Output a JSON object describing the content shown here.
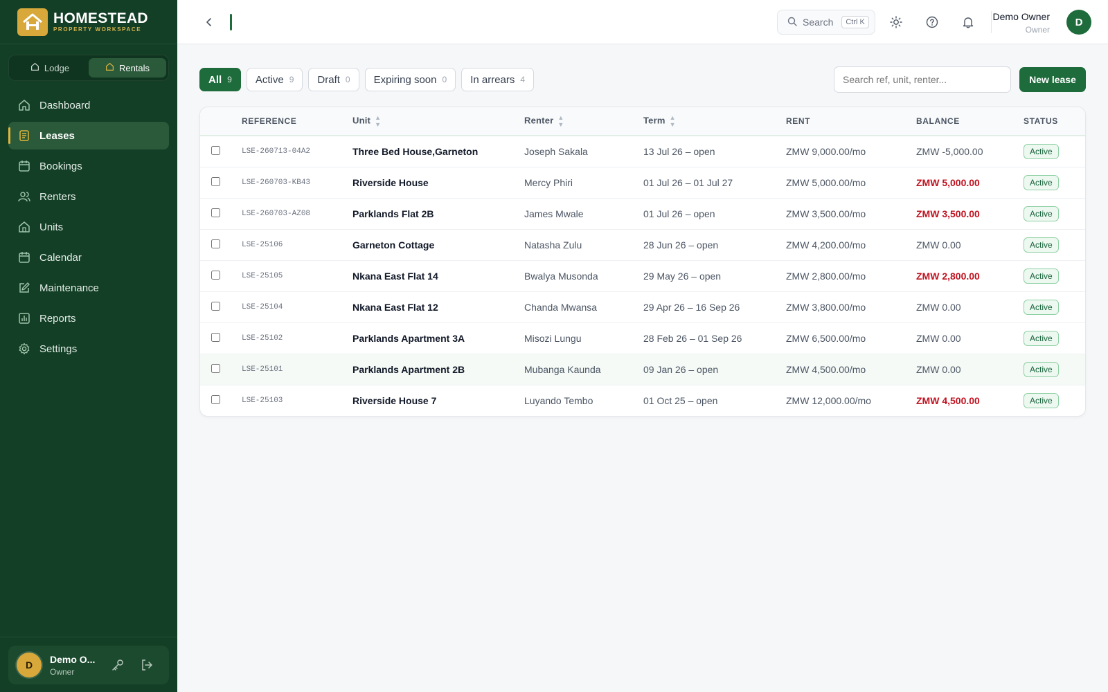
{
  "brand": {
    "name": "HOMESTEAD",
    "tagline": "PROPERTY WORKSPACE"
  },
  "mode_switch": [
    {
      "label": "Lodge",
      "active": false
    },
    {
      "label": "Rentals",
      "active": true
    }
  ],
  "sidebar": {
    "items": [
      {
        "label": "Dashboard",
        "icon": "home-icon",
        "active": false
      },
      {
        "label": "Leases",
        "icon": "document-icon",
        "active": true
      },
      {
        "label": "Bookings",
        "icon": "calendar-icon",
        "active": false
      },
      {
        "label": "Renters",
        "icon": "users-icon",
        "active": false
      },
      {
        "label": "Units",
        "icon": "building-icon",
        "active": false
      },
      {
        "label": "Calendar",
        "icon": "calendar-icon",
        "active": false
      },
      {
        "label": "Maintenance",
        "icon": "edit-icon",
        "active": false
      },
      {
        "label": "Reports",
        "icon": "chart-icon",
        "active": false
      },
      {
        "label": "Settings",
        "icon": "gear-icon",
        "active": false
      }
    ],
    "footer_user": {
      "initial": "D",
      "name": "Demo O...",
      "role": "Owner"
    }
  },
  "topbar": {
    "search_label": "Search",
    "search_shortcut": "Ctrl K",
    "user": {
      "name": "Demo Owner",
      "role": "Owner",
      "initial": "D"
    }
  },
  "filters": [
    {
      "label": "All",
      "count": "9",
      "active": true
    },
    {
      "label": "Active",
      "count": "9",
      "active": false
    },
    {
      "label": "Draft",
      "count": "0",
      "active": false
    },
    {
      "label": "Expiring soon",
      "count": "0",
      "active": false
    },
    {
      "label": "In arrears",
      "count": "4",
      "active": false
    }
  ],
  "table_search": {
    "placeholder": "Search ref, unit, renter..."
  },
  "new_lease_label": "New lease",
  "table": {
    "columns": {
      "reference": "REFERENCE",
      "unit": "Unit",
      "renter": "Renter",
      "term": "Term",
      "rent": "RENT",
      "balance": "BALANCE",
      "status": "STATUS"
    },
    "rows": [
      {
        "ref": "LSE-260713-04A2",
        "unit": "Three Bed House,Garneton",
        "renter": "Joseph Sakala",
        "term": "13 Jul 26 – open",
        "rent": "ZMW 9,000.00/mo",
        "balance": "ZMW -5,000.00",
        "arrears": false,
        "status": "Active"
      },
      {
        "ref": "LSE-260703-KB43",
        "unit": "Riverside House",
        "renter": "Mercy Phiri",
        "term": "01 Jul 26 – 01 Jul 27",
        "rent": "ZMW 5,000.00/mo",
        "balance": "ZMW 5,000.00",
        "arrears": true,
        "status": "Active"
      },
      {
        "ref": "LSE-260703-AZ08",
        "unit": "Parklands Flat 2B",
        "renter": "James Mwale",
        "term": "01 Jul 26 – open",
        "rent": "ZMW 3,500.00/mo",
        "balance": "ZMW 3,500.00",
        "arrears": true,
        "status": "Active"
      },
      {
        "ref": "LSE-25106",
        "unit": "Garneton Cottage",
        "renter": "Natasha Zulu",
        "term": "28 Jun 26 – open",
        "rent": "ZMW 4,200.00/mo",
        "balance": "ZMW 0.00",
        "arrears": false,
        "status": "Active"
      },
      {
        "ref": "LSE-25105",
        "unit": "Nkana East Flat 14",
        "renter": "Bwalya Musonda",
        "term": "29 May 26 – open",
        "rent": "ZMW 2,800.00/mo",
        "balance": "ZMW 2,800.00",
        "arrears": true,
        "status": "Active"
      },
      {
        "ref": "LSE-25104",
        "unit": "Nkana East Flat 12",
        "renter": "Chanda Mwansa",
        "term": "29 Apr 26 – 16 Sep 26",
        "rent": "ZMW 3,800.00/mo",
        "balance": "ZMW 0.00",
        "arrears": false,
        "status": "Active"
      },
      {
        "ref": "LSE-25102",
        "unit": "Parklands Apartment 3A",
        "renter": "Misozi Lungu",
        "term": "28 Feb 26 – 01 Sep 26",
        "rent": "ZMW 6,500.00/mo",
        "balance": "ZMW 0.00",
        "arrears": false,
        "status": "Active"
      },
      {
        "ref": "LSE-25101",
        "unit": "Parklands Apartment 2B",
        "renter": "Mubanga Kaunda",
        "term": "09 Jan 26 – open",
        "rent": "ZMW 4,500.00/mo",
        "balance": "ZMW 0.00",
        "arrears": false,
        "status": "Active"
      },
      {
        "ref": "LSE-25103",
        "unit": "Riverside House 7",
        "renter": "Luyando Tembo",
        "term": "01 Oct 25 – open",
        "rent": "ZMW 12,000.00/mo",
        "balance": "ZMW 4,500.00",
        "arrears": true,
        "status": "Active"
      }
    ]
  },
  "colors": {
    "sidebar": "#133f26",
    "accent": "#1e6b3c",
    "gold": "#d8a93a",
    "arrears": "#c0121f"
  }
}
